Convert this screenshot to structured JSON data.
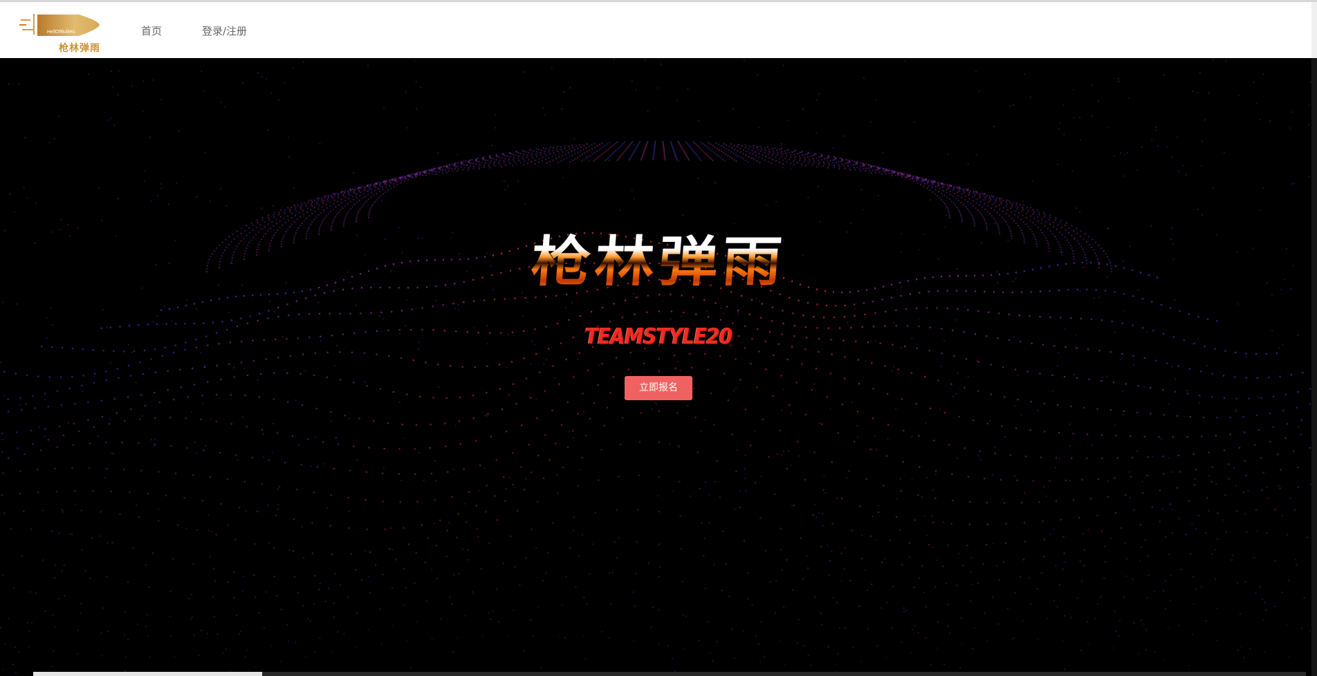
{
  "brand": {
    "logo_text": "枪林弹雨",
    "logo_sub": "HellOfBullets",
    "accent": "#c8962f"
  },
  "nav": {
    "home": "首页",
    "login": "登录/注册"
  },
  "hero": {
    "title": "枪林弹雨",
    "subtitle": "TEAMSTYLE20",
    "signup_label": "立即报名",
    "signup_color": "#f06261",
    "subtitle_color": "#ef2b22",
    "scroll_progress": 0.18
  }
}
